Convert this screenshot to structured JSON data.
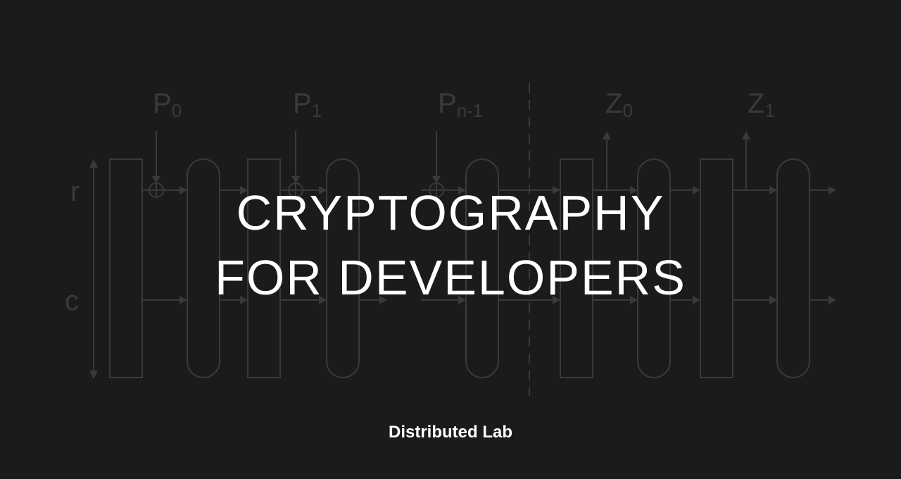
{
  "title": {
    "line1": "CRYPTOGRAPHY",
    "line2": "FOR DEVELOPERS"
  },
  "brand": "Distributed Lab",
  "diagram": {
    "rate_label": "r",
    "capacity_label": "c",
    "inputs": [
      {
        "base": "P",
        "sub": "0"
      },
      {
        "base": "P",
        "sub": "1"
      },
      {
        "base": "P",
        "sub": "n-1"
      }
    ],
    "outputs": [
      {
        "base": "Z",
        "sub": "0"
      },
      {
        "base": "Z",
        "sub": "1"
      }
    ]
  },
  "colors": {
    "background": "#1b1b1b",
    "diagram_stroke": "#3a3a3a",
    "text": "#ffffff"
  }
}
